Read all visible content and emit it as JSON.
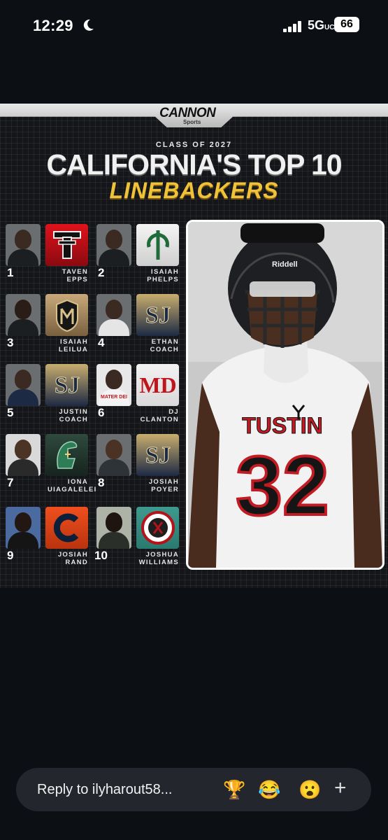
{
  "status": {
    "time": "12:29",
    "network": "5G",
    "network_suffix": "UC",
    "battery": "66"
  },
  "graphic": {
    "brand": "CANNON",
    "brand_sub": "Sports",
    "class_of": "CLASS OF 2027",
    "title": "CALIFORNIA'S TOP 10",
    "subtitle": "LINEBACKERS",
    "players": [
      {
        "rank": "1",
        "first": "TAVEN",
        "last": "EPPS",
        "logo": "red-tt-logo"
      },
      {
        "rank": "2",
        "first": "ISAIAH",
        "last": "PHELPS",
        "logo": "trident-logo"
      },
      {
        "rank": "3",
        "first": "ISAIAH",
        "last": "LEILUA",
        "logo": "crest-logo"
      },
      {
        "rank": "4",
        "first": "ETHAN",
        "last": "COACH",
        "logo": "sj-logo"
      },
      {
        "rank": "5",
        "first": "JUSTIN",
        "last": "COACH",
        "logo": "sj-logo"
      },
      {
        "rank": "6",
        "first": "DJ",
        "last": "CLANTON",
        "logo": "md-logo",
        "photo_text": "MATER DEI"
      },
      {
        "rank": "7",
        "first": "IONA",
        "last": "UIAGALELEI",
        "logo": "spartan-logo"
      },
      {
        "rank": "8",
        "first": "JOSIAH",
        "last": "POYER",
        "logo": "sj-logo"
      },
      {
        "rank": "9",
        "first": "JOSIAH",
        "last": "RAND",
        "logo": "c-logo"
      },
      {
        "rank": "10",
        "first": "JOSHUA",
        "last": "WILLIAMS",
        "logo": "sea-kings-logo"
      }
    ],
    "hero": {
      "team": "TUSTIN",
      "number": "32",
      "helmet_brand": "Riddell"
    }
  },
  "reply_bar": {
    "placeholder": "Reply to ilyharout58...",
    "reactions": [
      "🏆",
      "😂",
      "😮"
    ],
    "plus": "+"
  }
}
